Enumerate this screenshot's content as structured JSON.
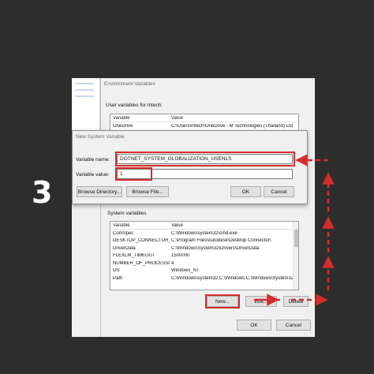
{
  "step_number": "3",
  "env_dialog": {
    "title": "Environment Variables",
    "user_section_label": "User variables for mtech",
    "user_columns": [
      "Variable",
      "Value"
    ],
    "user_rows": [
      {
        "name": "OneDrive",
        "value": "C:\\Users\\mtech\\OneDrive - M Technologies (Thailand) Ltd"
      }
    ],
    "system_section_label": "System variables",
    "system_columns": [
      "Variable",
      "Value"
    ],
    "system_rows": [
      {
        "name": "ComSpec",
        "value": "C:\\Windows\\system32\\cmd.exe"
      },
      {
        "name": "DESKTOP_CONNECTOR_DIR",
        "value": "C:\\Program Files\\Autodesk\\Desktop Connector\\"
      },
      {
        "name": "DriverData",
        "value": "C:\\Windows\\System32\\Drivers\\DriverData"
      },
      {
        "name": "FLEXLM_TIMEOUT",
        "value": "1500000"
      },
      {
        "name": "NUMBER_OF_PROCESSORS",
        "value": "4"
      },
      {
        "name": "OS",
        "value": "Windows_NT"
      },
      {
        "name": "Path",
        "value": "C:\\Windows\\system32;C:\\Windows;C:\\Windows\\System32\\Wb..."
      }
    ],
    "new_button": "New...",
    "edit_button": "Edit...",
    "delete_button": "Delete",
    "ok_button": "OK",
    "cancel_button": "Cancel"
  },
  "new_var_dialog": {
    "title": "New System Variable",
    "name_label": "Variable name:",
    "name_value": "DOTNET_SYSTEM_GLOBALIZATION_USENLS",
    "value_label": "Variable value:",
    "value_value": "1",
    "browse_directory_button": "Browse Directory...",
    "browse_file_button": "Browse File...",
    "ok_button": "OK",
    "cancel_button": "Cancel"
  },
  "colors": {
    "background": "#2d2d2d",
    "highlight": "#d32d2d",
    "selection": "#cce8ff"
  }
}
